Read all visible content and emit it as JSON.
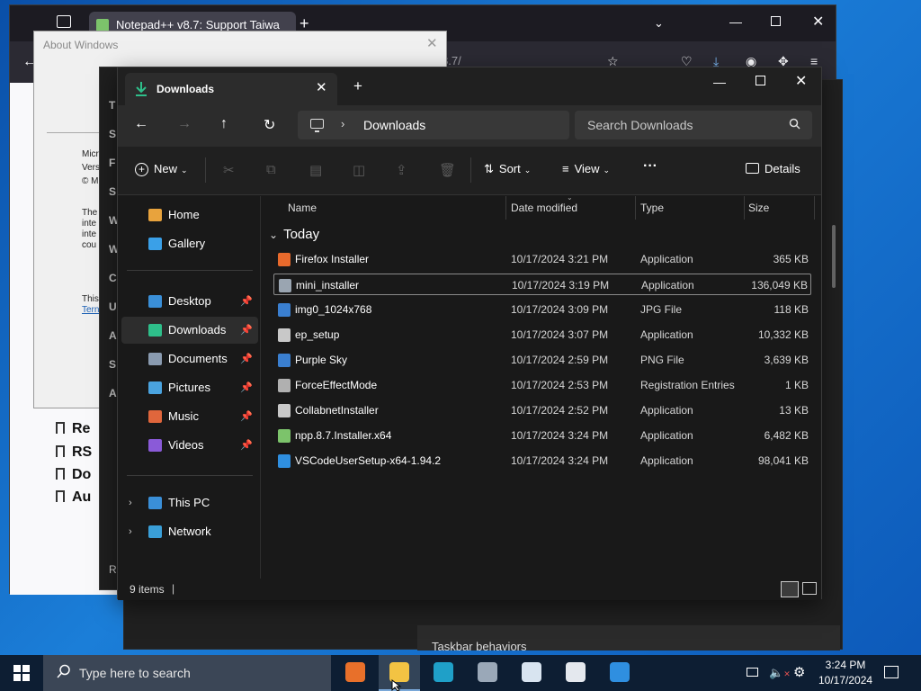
{
  "browser": {
    "tab_title": "Notepad++ v8.7: Support Taiwa",
    "url_fragment": "8.7/",
    "bookmarks": [
      "Re",
      "RS",
      "Do",
      "Au"
    ]
  },
  "about_window": {
    "title": "About Windows",
    "lines": [
      "Micr",
      "Vers",
      "© M",
      "The",
      "inte",
      "inte",
      "cou",
      "This",
      "Tern"
    ]
  },
  "notepad_side_letters": [
    "T",
    "S",
    "F",
    "S",
    "W",
    "W",
    "C",
    "U",
    "A",
    "S",
    "A",
    "R"
  ],
  "settings_window": {
    "section_title": "Taskbar behaviors"
  },
  "explorer": {
    "tab_label": "Downloads",
    "breadcrumb": "Downloads",
    "search_placeholder": "Search Downloads",
    "commands": {
      "new": "New",
      "sort": "Sort",
      "view": "View",
      "more": "···",
      "details": "Details"
    },
    "sidebar": {
      "quick": [
        {
          "label": "Home",
          "color": "#e8a33d"
        },
        {
          "label": "Gallery",
          "color": "#3aa0e8"
        }
      ],
      "pinned": [
        {
          "label": "Desktop",
          "color": "#3a8fd8",
          "pin": "📌"
        },
        {
          "label": "Downloads",
          "color": "#2ebf8a",
          "pin": "📌"
        },
        {
          "label": "Documents",
          "color": "#8a9bb0",
          "pin": "📌"
        },
        {
          "label": "Pictures",
          "color": "#4aa3df",
          "pin": "📌"
        },
        {
          "label": "Music",
          "color": "#e0663c",
          "pin": "📌"
        },
        {
          "label": "Videos",
          "color": "#8a5ad8",
          "pin": "📌"
        }
      ],
      "devices": [
        {
          "label": "This PC",
          "color": "#3a8fd8"
        },
        {
          "label": "Network",
          "color": "#3a9fd8"
        }
      ]
    },
    "columns": {
      "name": "Name",
      "date": "Date modified",
      "type": "Type",
      "size": "Size"
    },
    "group": "Today",
    "files": [
      {
        "name": "Firefox Installer",
        "date": "10/17/2024 3:21 PM",
        "type": "Application",
        "size": "365 KB",
        "color": "#e86a2c"
      },
      {
        "name": "mini_installer",
        "date": "10/17/2024 3:19 PM",
        "type": "Application",
        "size": "136,049 KB",
        "color": "#9aa5b1"
      },
      {
        "name": "img0_1024x768",
        "date": "10/17/2024 3:09 PM",
        "type": "JPG File",
        "size": "118 KB",
        "color": "#3a7fd0"
      },
      {
        "name": "ep_setup",
        "date": "10/17/2024 3:07 PM",
        "type": "Application",
        "size": "10,332 KB",
        "color": "#c8c8c8"
      },
      {
        "name": "Purple Sky",
        "date": "10/17/2024 2:59 PM",
        "type": "PNG File",
        "size": "3,639 KB",
        "color": "#3a7fd0"
      },
      {
        "name": "ForceEffectMode",
        "date": "10/17/2024 2:53 PM",
        "type": "Registration Entries",
        "size": "1 KB",
        "color": "#b0b0b0"
      },
      {
        "name": "CollabnetInstaller",
        "date": "10/17/2024 2:52 PM",
        "type": "Application",
        "size": "13 KB",
        "color": "#c8c8c8"
      },
      {
        "name": "npp.8.7.Installer.x64",
        "date": "10/17/2024 3:24 PM",
        "type": "Application",
        "size": "6,482 KB",
        "color": "#7cc36b"
      },
      {
        "name": "VSCodeUserSetup-x64-1.94.2",
        "date": "10/17/2024 3:24 PM",
        "type": "Application",
        "size": "98,041 KB",
        "color": "#2f8fe0"
      }
    ],
    "status": {
      "count": "9 items",
      "separator": "|"
    }
  },
  "taskbar": {
    "search_placeholder": "Type here to search",
    "apps": [
      {
        "name": "firefox",
        "color": "#e8702a"
      },
      {
        "name": "file-explorer",
        "color": "#f3c343",
        "active": true
      },
      {
        "name": "edge",
        "color": "#1fa0c8"
      },
      {
        "name": "settings",
        "color": "#9aa8b8"
      },
      {
        "name": "window-app",
        "color": "#d8e4f0"
      },
      {
        "name": "notepad",
        "color": "#e4e8ee"
      },
      {
        "name": "vscode",
        "color": "#2f8fe0"
      }
    ],
    "time": "3:24 PM",
    "date": "10/17/2024"
  }
}
